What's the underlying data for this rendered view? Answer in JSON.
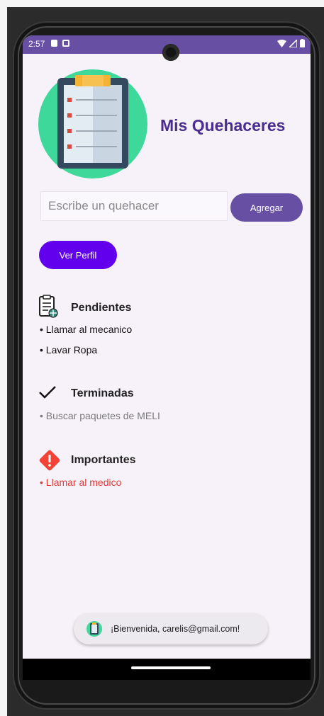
{
  "status_bar": {
    "time": "2:57"
  },
  "app": {
    "title": "Mis Quehaceres"
  },
  "form": {
    "input_placeholder": "Escribe un quehacer",
    "add_button": "Agregar",
    "profile_button": "Ver Perfil"
  },
  "sections": {
    "pending": {
      "title": "Pendientes",
      "icon": "clipboard-icon",
      "items": [
        "• Llamar al mecanico",
        "• Lavar Ropa"
      ]
    },
    "done": {
      "title": "Terminadas",
      "icon": "checkmark-icon",
      "items": [
        "• Buscar paquetes de MELI"
      ]
    },
    "important": {
      "title": "Importantes",
      "icon": "warning-icon",
      "items": [
        "• Llamar al medico"
      ]
    }
  },
  "toast": {
    "message": "¡Bienvenida, carelis@gmail.com!"
  },
  "colors": {
    "primary": "#6750a4",
    "accent": "#6200ee",
    "title": "#4a2d8f",
    "important": "#e53935",
    "background": "#f7f2fa"
  }
}
